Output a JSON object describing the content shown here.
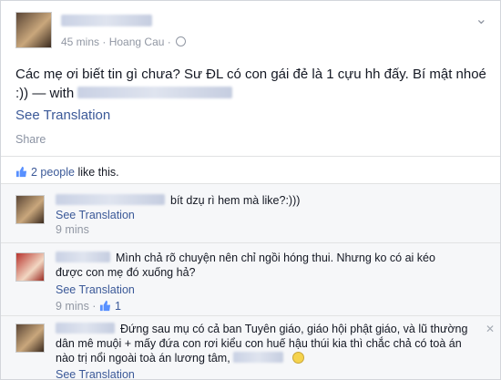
{
  "post": {
    "time": "45 mins",
    "separator": "·",
    "location": "Hoang Cau",
    "text": "Các mẹ ơi biết tin gì chưa? Sư ĐL có con gái đẻ là 1 cựu hh đấy. Bí mật nhoé :)) — with",
    "see_translation": "See Translation",
    "share": "Share",
    "likes_count": "2 people",
    "likes_suffix": "like this."
  },
  "comments": [
    {
      "text": "bít dzụ rì hem mà like?:)))",
      "see_translation": "See Translation",
      "time": "9 mins"
    },
    {
      "text_line1": "Mình chả rõ chuyện nên chỉ ngồi hóng thui. Nhưng ko có ai kéo",
      "text_line2": "được con mẹ đó xuống hả?",
      "see_translation": "See Translation",
      "time": "9 mins",
      "like_count": "1"
    },
    {
      "text_line1": "Đứng sau mụ có cả ban Tuyên giáo, giáo hội phật giáo, và lũ thường",
      "text_line2": "dân mê muội + mấy đứa con rơi kiểu con huế hậu thúi kia thì chắc chả có toà án",
      "text_line3": "nào trị nổi ngoài toà án lương tâm,",
      "see_translation": "See Translation"
    }
  ]
}
